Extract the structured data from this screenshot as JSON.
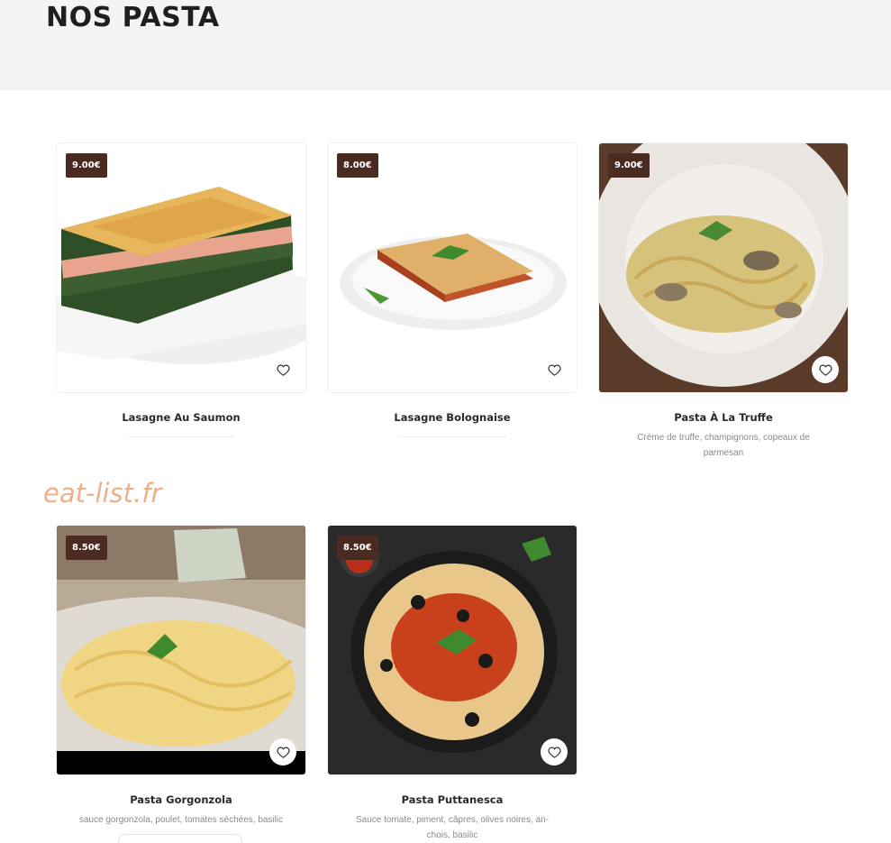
{
  "page": {
    "title": "NOS PASTA"
  },
  "watermark": "eat-list.fr",
  "products": [
    {
      "name": "Lasagne Au Saumon",
      "price": "9.00€",
      "description": "",
      "image": "salmon-lasagna-photo"
    },
    {
      "name": "Lasagne Bolognaise",
      "price": "8.00€",
      "description": "",
      "image": "bolognese-lasagna-photo"
    },
    {
      "name": "Pasta À La Truffe",
      "price": "9.00€",
      "description": "Crème de truffe, champignons, copeaux de parmesan",
      "image": "truffle-pasta-photo"
    },
    {
      "name": "Pasta Gorgonzola",
      "price": "8.50€",
      "description": "sauce gorgonzola, poulet, tomates séchées, basilic",
      "image": "gorgonzola-pasta-photo"
    },
    {
      "name": "Pasta Puttanesca",
      "price": "8.50€",
      "description": "Sauce tomate, piment, câpres, olives noires, an-chois, basilic",
      "image": "puttanesca-pasta-photo"
    }
  ],
  "icons": {
    "favorite": "heart-outline-icon"
  },
  "colors": {
    "price_badge": "#4a2b21",
    "header_bg": "#f4f4f4",
    "watermark": "#f0b089"
  }
}
